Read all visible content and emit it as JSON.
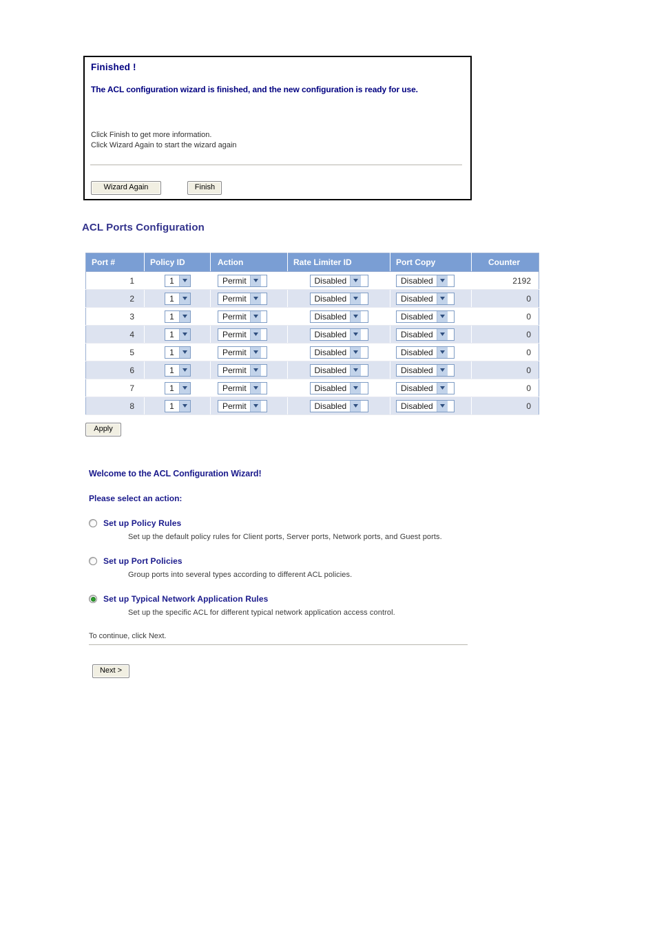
{
  "finished_panel": {
    "title": "Finished !",
    "subtitle": "The ACL configuration wizard is finished, and the new configuration is ready for use.",
    "hint_line1": "Click Finish to get more information.",
    "hint_line2": "Click Wizard Again to start the wizard again",
    "wizard_again_label": "Wizard Again",
    "finish_label": "Finish"
  },
  "acl_ports": {
    "section_title": "ACL Ports Configuration",
    "columns": [
      "Port #",
      "Policy ID",
      "Action",
      "Rate Limiter ID",
      "Port Copy",
      "Counter"
    ],
    "rows": [
      {
        "port": "1",
        "policy_id": "1",
        "action": "Permit",
        "rate_limiter_id": "Disabled",
        "port_copy": "Disabled",
        "counter": "2192"
      },
      {
        "port": "2",
        "policy_id": "1",
        "action": "Permit",
        "rate_limiter_id": "Disabled",
        "port_copy": "Disabled",
        "counter": "0"
      },
      {
        "port": "3",
        "policy_id": "1",
        "action": "Permit",
        "rate_limiter_id": "Disabled",
        "port_copy": "Disabled",
        "counter": "0"
      },
      {
        "port": "4",
        "policy_id": "1",
        "action": "Permit",
        "rate_limiter_id": "Disabled",
        "port_copy": "Disabled",
        "counter": "0"
      },
      {
        "port": "5",
        "policy_id": "1",
        "action": "Permit",
        "rate_limiter_id": "Disabled",
        "port_copy": "Disabled",
        "counter": "0"
      },
      {
        "port": "6",
        "policy_id": "1",
        "action": "Permit",
        "rate_limiter_id": "Disabled",
        "port_copy": "Disabled",
        "counter": "0"
      },
      {
        "port": "7",
        "policy_id": "1",
        "action": "Permit",
        "rate_limiter_id": "Disabled",
        "port_copy": "Disabled",
        "counter": "0"
      },
      {
        "port": "8",
        "policy_id": "1",
        "action": "Permit",
        "rate_limiter_id": "Disabled",
        "port_copy": "Disabled",
        "counter": "0"
      }
    ],
    "apply_label": "Apply"
  },
  "wizard": {
    "title": "Welcome to the ACL Configuration Wizard!",
    "prompt": "Please select an action:",
    "options": [
      {
        "label": "Set up Policy Rules",
        "description": "Set up the default policy rules for Client ports, Server ports, Network ports, and Guest ports.",
        "selected": false
      },
      {
        "label": "Set up Port Policies",
        "description": "Group ports into several types according to different ACL policies.",
        "selected": false
      },
      {
        "label": "Set up Typical Network Application Rules",
        "description": "Set up the specific ACL for different typical network application access control.",
        "selected": true
      }
    ],
    "continue_text": "To continue, click Next.",
    "next_label": "Next >"
  },
  "colors": {
    "table_header_bg": "#7a9ed4",
    "table_row_alt_bg": "#dde3f0",
    "heading_navy": "#000080",
    "section_title": "#33338c",
    "radio_selected": "#2e9e2e"
  }
}
